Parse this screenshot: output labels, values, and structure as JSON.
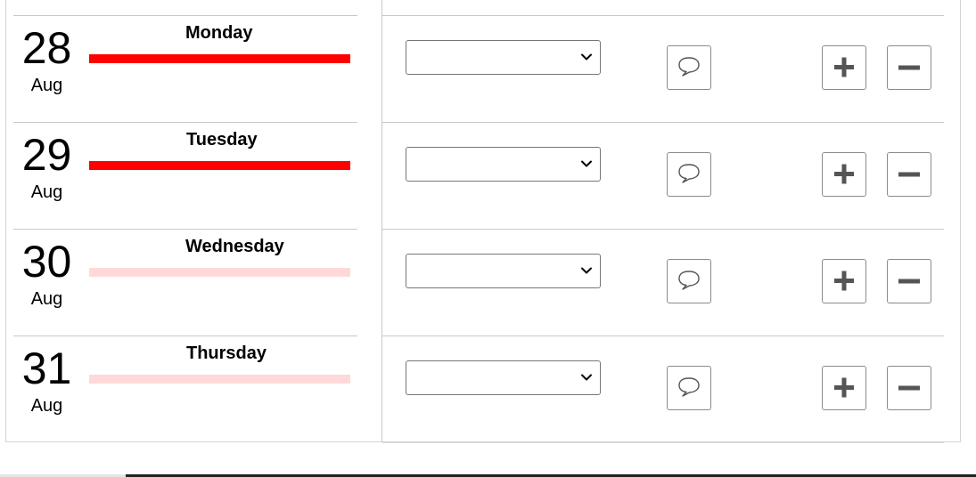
{
  "days": [
    {
      "day": "28",
      "month": "Aug",
      "weekday": "Monday",
      "fill_color": "#ff0000",
      "selected_value": ""
    },
    {
      "day": "29",
      "month": "Aug",
      "weekday": "Tuesday",
      "fill_color": "#ff0000",
      "selected_value": ""
    },
    {
      "day": "30",
      "month": "Aug",
      "weekday": "Wednesday",
      "fill_color": "#ffd9d9",
      "selected_value": ""
    },
    {
      "day": "31",
      "month": "Aug",
      "weekday": "Thursday",
      "fill_color": "#ffd9d9",
      "selected_value": ""
    }
  ],
  "icons": {
    "comment": "speech-bubble-icon",
    "add": "plus-icon",
    "remove": "minus-icon",
    "dropdown": "chevron-down-icon"
  },
  "colors": {
    "bar_strong": "#ff0000",
    "bar_light": "#ffd9d9",
    "icon_gray": "#555555"
  }
}
